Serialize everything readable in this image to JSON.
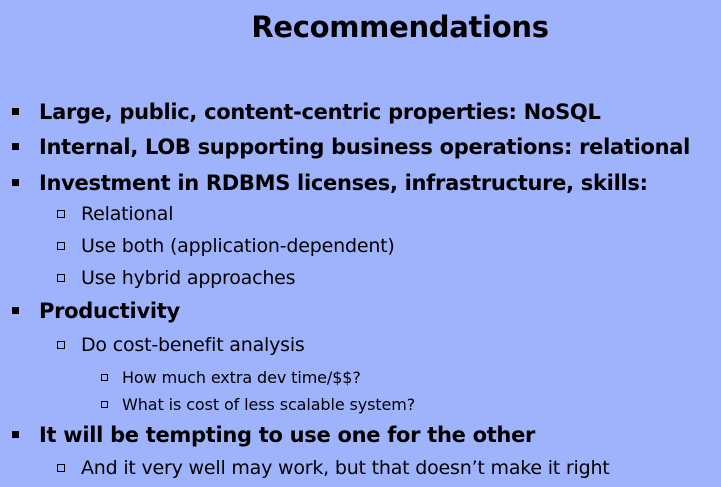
{
  "slide": {
    "title": "Recommendations",
    "items": [
      {
        "text": "Large, public, content-centric properties: NoSQL"
      },
      {
        "text": "Internal, LOB supporting business operations: relational"
      },
      {
        "text": "Investment in RDBMS licenses, infrastructure, skills:"
      },
      {
        "text": "Relational"
      },
      {
        "text": "Use both (application-dependent)"
      },
      {
        "text": "Use hybrid approaches"
      },
      {
        "text": "Productivity"
      },
      {
        "text": "Do cost-benefit analysis"
      },
      {
        "text": "How much extra dev time/$$?"
      },
      {
        "text": "What is cost of less scalable system?"
      },
      {
        "text": "It will be tempting to use one for the other"
      },
      {
        "text": "And it very well may work, but that doesn’t make it right"
      }
    ]
  }
}
